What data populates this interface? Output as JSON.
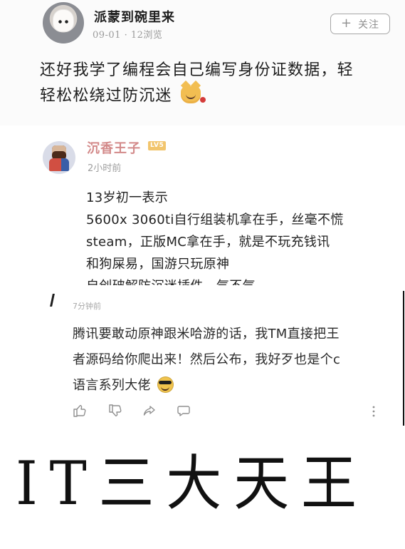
{
  "top_post": {
    "author": "派蒙到碗里来",
    "meta": "09-01 · 12浏览",
    "follow_button": "关注",
    "follow_icon": "plus-icon",
    "content_line_1": "还好我学了编程会自己编写身份证数据，轻",
    "content_line_2": "轻松松绕过防沉迷"
  },
  "middle_post": {
    "author": "沉香王子",
    "badge": "LV5",
    "time": "2小时前",
    "lines": [
      "13岁初一表示",
      "5600x 3060ti自行组装机拿在手，丝毫不慌",
      "steam，正版MC拿在手，就是不玩充钱讯",
      "和狗屎易，国游只玩原神",
      "自创破解防沉迷插件，气不气"
    ]
  },
  "bottom_post": {
    "time": "7分钟前",
    "lines": [
      "腾讯要敢动原神跟米哈游的话，我TM直接把王",
      "者源码给你爬出来！然后公布，我好歹也是个c",
      "语言系列大佬"
    ],
    "actions": [
      {
        "icon": "thumbs-up-icon"
      },
      {
        "icon": "thumbs-down-icon"
      },
      {
        "icon": "share-icon"
      },
      {
        "icon": "comment-icon"
      },
      {
        "icon": "more-icon"
      }
    ]
  },
  "caption": {
    "text": "IT三大天王"
  },
  "colors": {
    "name_pink": "#d38a8a",
    "muted_gray": "#9e9e9e",
    "text_dark": "#222222",
    "badge_gold": "#f2c56d"
  }
}
